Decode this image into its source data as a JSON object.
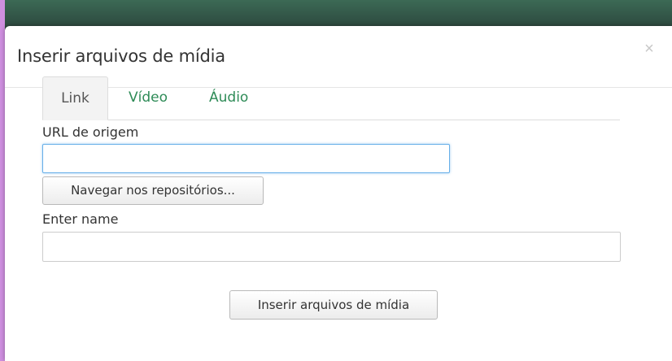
{
  "modal": {
    "title": "Inserir arquivos de mídia",
    "close_glyph": "×"
  },
  "tabs": [
    {
      "label": "Link",
      "active": true
    },
    {
      "label": "Vídeo",
      "active": false
    },
    {
      "label": "Áudio",
      "active": false
    }
  ],
  "form": {
    "url_label": "URL de origem",
    "url_value": "",
    "browse_button": "Navegar nos repositórios...",
    "name_label": "Enter name",
    "name_value": "",
    "submit_button": "Inserir arquivos de mídia"
  },
  "colors": {
    "tab_link_color": "#2e8b57",
    "focus_border": "#66afe9",
    "page_border": "#cf8fe0"
  }
}
